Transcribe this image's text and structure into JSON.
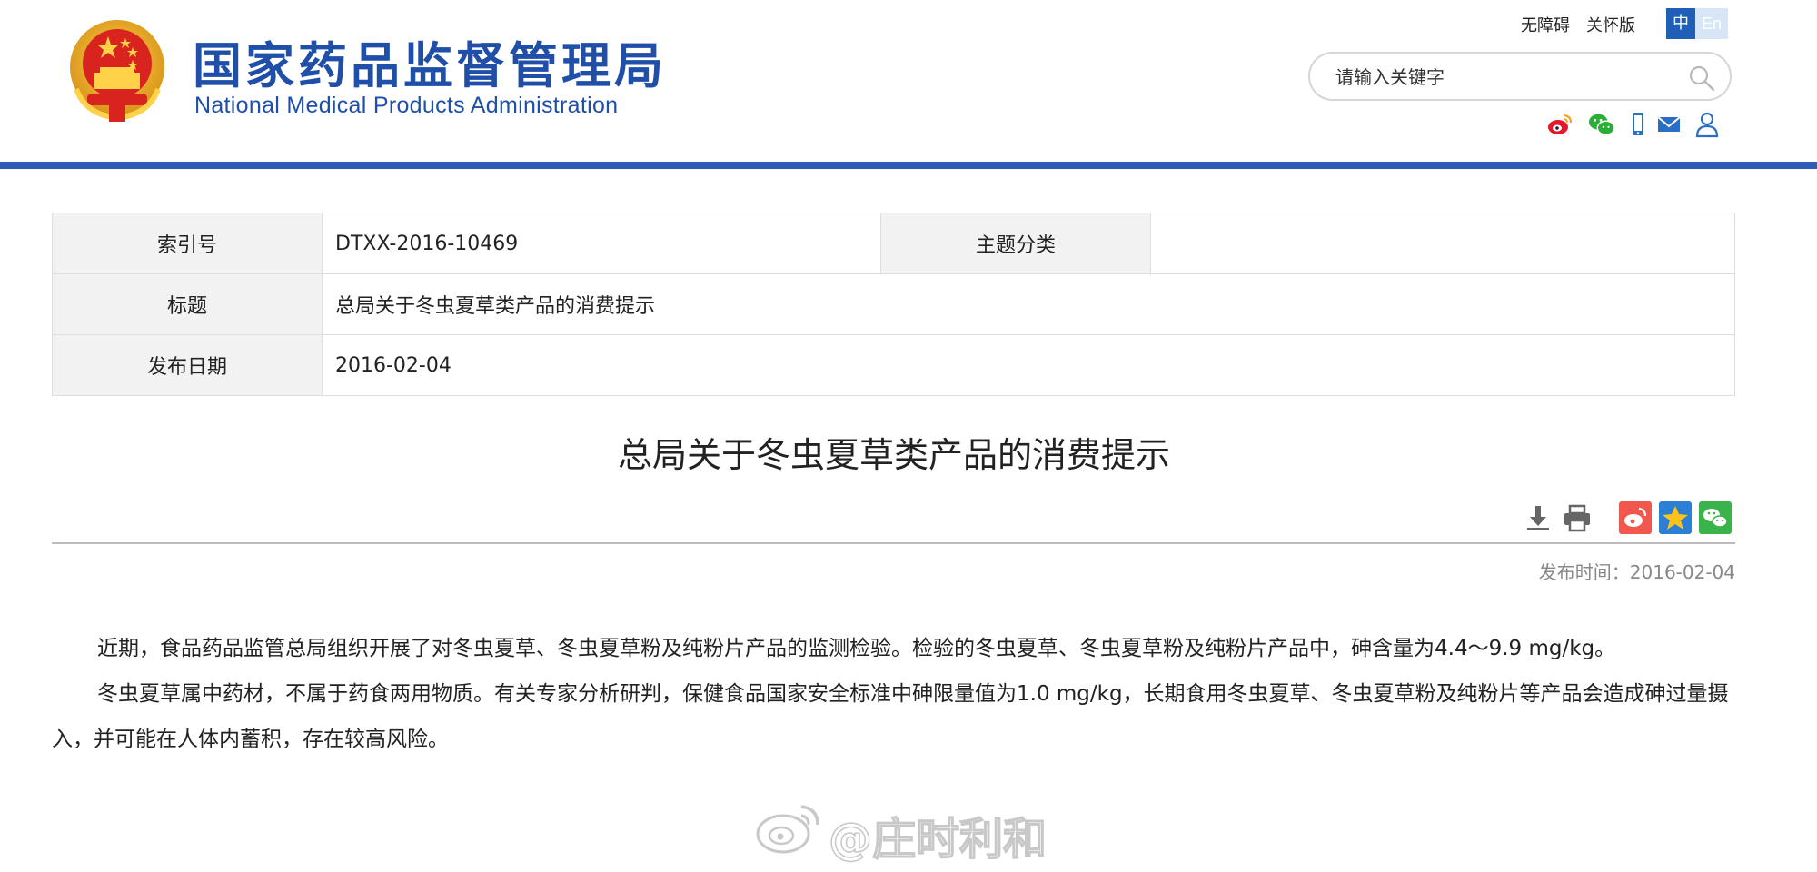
{
  "header": {
    "site_title_cn": "国家药品监督管理局",
    "site_title_en": "National Medical Products Administration",
    "accessibility_label": "无障碍",
    "care_mode_label": "关怀版",
    "lang_zh": "中",
    "lang_en": "En",
    "search_placeholder": "请输入关键字",
    "social_icons": [
      "weibo-icon",
      "wechat-icon",
      "mobile-icon",
      "mail-icon",
      "user-icon"
    ],
    "brand_color": "#1f4fa8"
  },
  "meta": {
    "index_label": "索引号",
    "index_value": "DTXX-2016-10469",
    "topic_label": "主题分类",
    "topic_value": "",
    "title_label": "标题",
    "title_value": "总局关于冬虫夏草类产品的消费提示",
    "date_label": "发布日期",
    "date_value": "2016-02-04"
  },
  "article": {
    "title": "总局关于冬虫夏草类产品的消费提示",
    "tools": [
      "download-icon",
      "print-icon",
      "share-weibo-icon",
      "share-qzone-icon",
      "share-wechat-icon"
    ],
    "pub_time_label": "发布时间：",
    "pub_time_value": "2016-02-04",
    "paragraphs": [
      "近期，食品药品监管总局组织开展了对冬虫夏草、冬虫夏草粉及纯粉片产品的监测检验。检验的冬虫夏草、冬虫夏草粉及纯粉片产品中，砷含量为4.4～9.9 mg/kg。",
      "冬虫夏草属中药材，不属于药食两用物质。有关专家分析研判，保健食品国家安全标准中砷限量值为1.0 mg/kg，长期食用冬虫夏草、冬虫夏草粉及纯粉片等产品会造成砷过量摄入，并可能在人体内蓄积，存在较高风险。"
    ]
  },
  "watermark": {
    "text": "@庄时利和"
  }
}
